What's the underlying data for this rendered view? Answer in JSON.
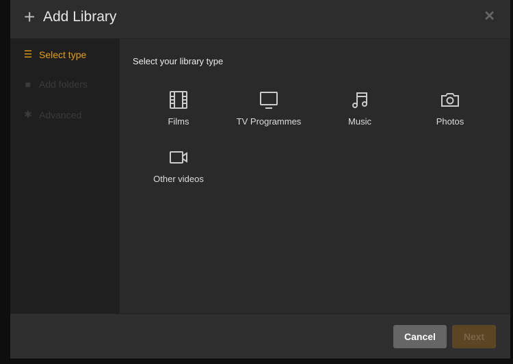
{
  "header": {
    "title": "Add Library",
    "close_icon": "close-icon"
  },
  "sidebar": {
    "items": [
      {
        "label": "Select type",
        "icon": "list-icon",
        "active": true
      },
      {
        "label": "Add folders",
        "icon": "folder-icon",
        "active": false
      },
      {
        "label": "Advanced",
        "icon": "gear-icon",
        "active": false
      }
    ]
  },
  "main": {
    "prompt": "Select your library type",
    "types": [
      {
        "label": "Films"
      },
      {
        "label": "TV Programmes"
      },
      {
        "label": "Music"
      },
      {
        "label": "Photos"
      },
      {
        "label": "Other videos"
      }
    ]
  },
  "footer": {
    "cancel": "Cancel",
    "next": "Next"
  },
  "colors": {
    "accent": "#e5a00d",
    "disabled_next": "#5c4525"
  }
}
